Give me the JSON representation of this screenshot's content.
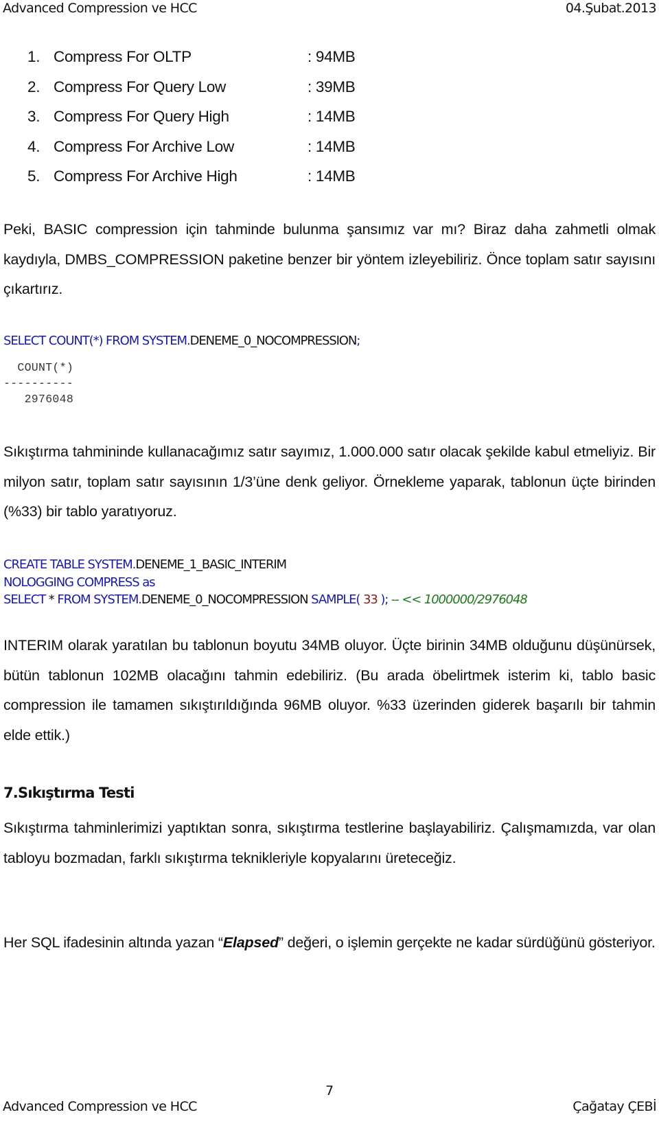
{
  "header": {
    "left": "Advanced Compression ve HCC",
    "right": "04.Şubat.2013"
  },
  "compression_results": [
    {
      "num": "1.",
      "label": "Compress For OLTP",
      "value": ": 94MB"
    },
    {
      "num": "2.",
      "label": "Compress For Query Low",
      "value": ": 39MB"
    },
    {
      "num": "3.",
      "label": "Compress For Query High",
      "value": ": 14MB"
    },
    {
      "num": "4.",
      "label": "Compress For Archive Low",
      "value": ": 14MB"
    },
    {
      "num": "5.",
      "label": "Compress For Archive High",
      "value": ": 14MB"
    }
  ],
  "para1": "Peki, BASIC compression için tahminde bulunma şansımız var mı? Biraz daha zahmetli olmak kaydıyla, DMBS_COMPRESSION paketine benzer bir yöntem izleyebiliriz. Önce toplam satır sayısını çıkartırız.",
  "sql1": {
    "kw1": "SELECT COUNT(*) FROM SYSTEM.",
    "id1": "DENEME_0_NOCOMPRESSION",
    "end": ";"
  },
  "sql1_output": {
    "column": "  COUNT(*)",
    "separator": "----------",
    "value": "   2976048"
  },
  "para2": "Sıkıştırma tahmininde kullanacağımız satır sayımız, 1.000.000 satır olacak şekilde kabul etmeliyiz. Bir milyon satır, toplam satır sayısının 1/3’üne denk geliyor. Örnekleme yaparak, tablonun üçte birinden (%33) bir tablo yaratıyoruz.",
  "sql2": {
    "line1_kw": "CREATE TABLE SYSTEM.",
    "line1_id": "DENEME_1_BASIC_INTERIM",
    "line2_kw": "NOLOGGING COMPRESS as",
    "line3_kw1": "SELECT ",
    "line3_star": "* ",
    "line3_kw2": "FROM SYSTEM.",
    "line3_id": "DENEME_0_NOCOMPRESSION ",
    "line3_kw3": "SAMPLE( ",
    "line3_num": "33",
    "line3_kw4": " ); ",
    "line3_cmt": "-- << ",
    "line3_cmt_val": "1000000/2976048"
  },
  "para3": "INTERIM olarak yaratılan bu tablonun boyutu 34MB oluyor. Üçte birinin 34MB olduğunu düşünürsek, bütün tablonun 102MB olacağını tahmin edebiliriz. (Bu arada öbelirtmek isterim ki, tablo basic compression ile tamamen sıkıştırıldığında 96MB oluyor. %33 üzerinden giderek başarılı bir tahmin elde ettik.)",
  "section_heading": "7.Sıkıştırma Testi",
  "para4": "Sıkıştırma tahminlerimizi yaptıktan sonra, sıkıştırma testlerine başlayabiliriz. Çalışmamızda, var olan tabloyu bozmadan, farklı sıkıştırma teknikleriyle kopyalarını üreteceğiz.",
  "para5": {
    "before": "Her SQL ifadesinin altında yazan “",
    "emphasis": "Elapsed",
    "after": "” değeri, o işlemin gerçekte ne kadar sürdüğünü gösteriyor."
  },
  "page_number": "7",
  "footer": {
    "left": "Advanced Compression ve HCC",
    "right": "Çağatay ÇEBİ"
  }
}
